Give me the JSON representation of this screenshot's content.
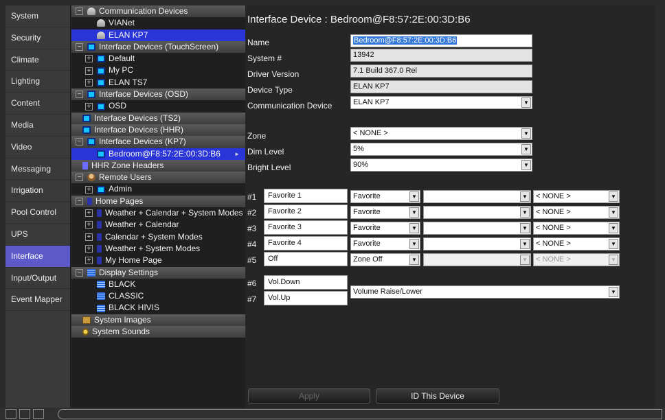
{
  "sidebar": {
    "items": [
      {
        "label": "System"
      },
      {
        "label": "Security"
      },
      {
        "label": "Climate"
      },
      {
        "label": "Lighting"
      },
      {
        "label": "Content"
      },
      {
        "label": "Media"
      },
      {
        "label": "Video"
      },
      {
        "label": "Messaging"
      },
      {
        "label": "Irrigation"
      },
      {
        "label": "Pool Control"
      },
      {
        "label": "UPS"
      },
      {
        "label": "Interface"
      },
      {
        "label": "Input/Output"
      },
      {
        "label": "Event Mapper"
      }
    ],
    "active": "Interface"
  },
  "tree": {
    "rows": [
      {
        "label": "Communication Devices",
        "icon": "comm-icon",
        "group": true,
        "expander": "−"
      },
      {
        "label": "VIANet",
        "icon": "comm-icon"
      },
      {
        "label": "ELAN KP7",
        "icon": "comm-icon",
        "selected": true
      },
      {
        "label": "Interface Devices (TouchScreen)",
        "icon": "screen-icon",
        "group": true,
        "expander": "−"
      },
      {
        "label": "Default",
        "icon": "screen-icon",
        "expander": "+"
      },
      {
        "label": "My PC",
        "icon": "screen-icon",
        "expander": "+"
      },
      {
        "label": "ELAN TS7",
        "icon": "screen-icon",
        "expander": "+"
      },
      {
        "label": "Interface Devices (OSD)",
        "icon": "screen-icon",
        "group": true,
        "expander": "−"
      },
      {
        "label": "OSD",
        "icon": "screen-icon",
        "expander": "+"
      },
      {
        "label": "Interface Devices (TS2)",
        "icon": "screen-icon",
        "group": true
      },
      {
        "label": "Interface Devices (HHR)",
        "icon": "screen-icon",
        "group": true
      },
      {
        "label": "Interface Devices (KP7)",
        "icon": "screen-icon",
        "group": true,
        "expander": "−"
      },
      {
        "label": "Bedroom@F8:57:2E:00:3D:B6",
        "icon": "screen-icon",
        "selected": true,
        "arrow": "►"
      },
      {
        "label": "HHR Zone Headers",
        "icon": "hhr-icon",
        "group": true
      },
      {
        "label": "Remote Users",
        "icon": "user-icon",
        "group": true,
        "expander": "−"
      },
      {
        "label": "Admin",
        "icon": "screen-icon",
        "expander": "+"
      },
      {
        "label": "Home Pages",
        "icon": "page-icon",
        "group": true,
        "expander": "−"
      },
      {
        "label": "Weather + Calendar + System Modes",
        "icon": "page-icon",
        "expander": "+"
      },
      {
        "label": "Weather + Calendar",
        "icon": "page-icon",
        "expander": "+"
      },
      {
        "label": "Calendar + System Modes",
        "icon": "page-icon",
        "expander": "+"
      },
      {
        "label": "Weather + System Modes",
        "icon": "page-icon",
        "expander": "+"
      },
      {
        "label": "My Home Page",
        "icon": "page-icon",
        "expander": "+"
      },
      {
        "label": "Display Settings",
        "icon": "display-icon",
        "group": true,
        "expander": "−"
      },
      {
        "label": "BLACK",
        "icon": "display-icon"
      },
      {
        "label": "CLASSIC",
        "icon": "display-icon"
      },
      {
        "label": "BLACK HIVIS",
        "icon": "display-icon"
      },
      {
        "label": "System Images",
        "icon": "image-icon",
        "group": true
      },
      {
        "label": "System Sounds",
        "icon": "sound-icon",
        "group": true
      }
    ]
  },
  "main": {
    "title": "Interface Device : Bedroom@F8:57:2E:00:3D:B6",
    "fields": {
      "name_label": "Name",
      "name_value": "Bedroom@F8:57:2E:00:3D:B6",
      "system_label": "System #",
      "system_value": "13942",
      "driver_label": "Driver Version",
      "driver_value": "7.1 Build 367.0 Rel",
      "type_label": "Device Type",
      "type_value": "ELAN KP7",
      "comm_label": "Communication Device",
      "comm_value": "ELAN KP7",
      "zone_label": "Zone",
      "zone_value": "< NONE >",
      "dim_label": "Dim Level",
      "dim_value": "5%",
      "bright_label": "Bright Level",
      "bright_value": "90%"
    },
    "favorites": [
      {
        "num": "#1",
        "name": "Favorite 1",
        "type": "Favorite",
        "target": "",
        "zone": "< NONE >"
      },
      {
        "num": "#2",
        "name": "Favorite 2",
        "type": "Favorite",
        "target": "",
        "zone": "< NONE >"
      },
      {
        "num": "#3",
        "name": "Favorite 3",
        "type": "Favorite",
        "target": "",
        "zone": "< NONE >"
      },
      {
        "num": "#4",
        "name": "Favorite 4",
        "type": "Favorite",
        "target": "",
        "zone": "< NONE >"
      },
      {
        "num": "#5",
        "name": "Off",
        "type": "Zone Off",
        "target": "",
        "zone": "< NONE >"
      }
    ],
    "volume": {
      "num6": "#6",
      "down": "Vol.Down",
      "num7": "#7",
      "up": "Vol.Up",
      "mode": "Volume Raise/Lower"
    },
    "buttons": {
      "apply": "Apply",
      "id_device": "ID This Device"
    }
  }
}
